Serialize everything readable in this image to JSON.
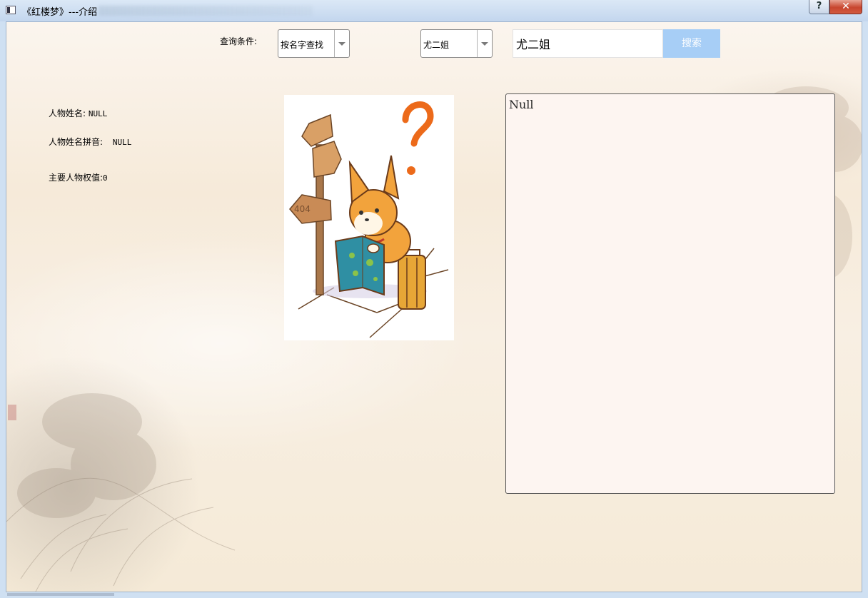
{
  "window": {
    "title": "《红楼梦》---介绍",
    "help_label": "?",
    "close_label": "✕",
    "icon": "app-window-icon"
  },
  "search": {
    "condition_label": "查询条件:",
    "mode_selected": "按名字查找",
    "name_selected": "尤二姐",
    "input_value": "尤二姐",
    "button_label": "搜索",
    "button_color": "#a7cef6"
  },
  "character": {
    "name_label": "人物姓名:",
    "name_value": "NULL",
    "pinyin_label": "人物姓名拼音:",
    "pinyin_value": "NULL",
    "weight_label": "主要人物权值:",
    "weight_value": "0"
  },
  "image": {
    "signpost_text": "404",
    "icon": "not-found-fox-illustration"
  },
  "detail": {
    "text": "Null"
  }
}
